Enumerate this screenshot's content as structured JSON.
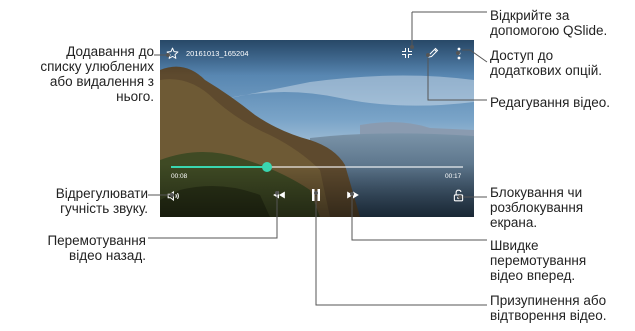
{
  "video": {
    "filename": "20161013_165204",
    "elapsed": "00:08",
    "duration": "00:17",
    "progress": 0.33
  },
  "callouts": {
    "favorite": "Додавання до\nсписку улюблених\nабо видалення з\nнього.",
    "volume": "Відрегулювати\nгучність звуку.",
    "rewind": "Перемотування\nвідео назад.",
    "qslide": "Відкрийте за\nдопомогою QSlide.",
    "more_options": "Доступ до\nдодаткових опцій.",
    "edit": "Редагування відео.",
    "lock": "Блокування чи\nрозблокування\nекрана.",
    "fast_forward": "Швидке\nперемотування\nвідео вперед.",
    "play_pause": "Призупинення або\nвідтворення відео."
  },
  "icons": {
    "favorite": "star-outline-icon",
    "qslide": "qslide-icon",
    "edit": "pencil-icon",
    "more": "more-vertical-icon",
    "volume": "speaker-icon",
    "rewind": "rewind-icon",
    "pause": "pause-icon",
    "fast_forward": "fast-forward-icon",
    "lock": "unlock-icon"
  },
  "colors": {
    "progress": "#3ad6b0",
    "leader": "#555555"
  }
}
